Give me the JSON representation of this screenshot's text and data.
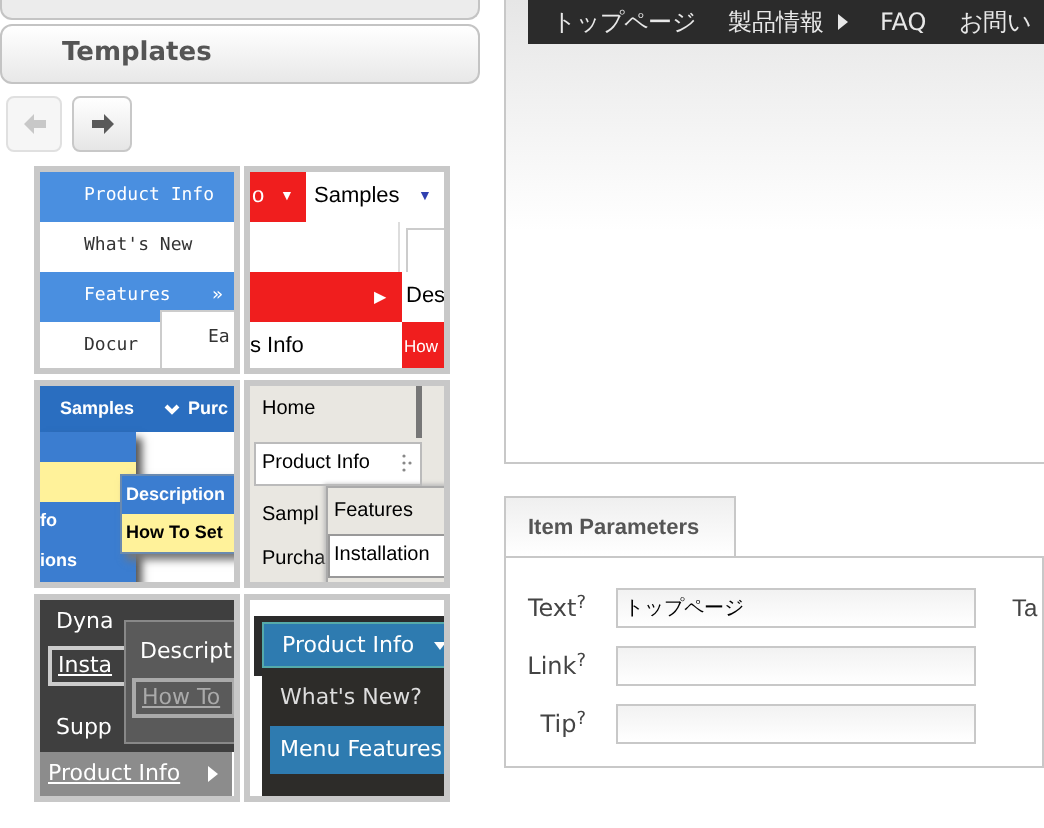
{
  "sidebar": {
    "templates_header": "Templates",
    "nav_buttons": [
      {
        "kind": "back",
        "disabled": true
      },
      {
        "kind": "forward",
        "disabled": false
      }
    ],
    "templates": [
      {
        "kind": "blue-classic",
        "items": [
          "Product Info",
          "What's New",
          "Features",
          "»",
          "Docur",
          "Ea"
        ]
      },
      {
        "kind": "red-flat",
        "items": [
          "o",
          "▼",
          "Samples",
          "▼",
          "▶",
          "Des",
          "s Info",
          "How"
        ]
      },
      {
        "kind": "blue-yellow",
        "items": [
          "Samples",
          "Purc",
          "fo",
          "ions",
          "Description",
          "How To Set"
        ]
      },
      {
        "kind": "light-gray",
        "items": [
          "Home",
          "Product Info",
          "Sampl",
          "Purcha",
          "Features",
          "Installation"
        ]
      },
      {
        "kind": "dark-gray",
        "items": [
          "Dyna",
          "Insta",
          "Supp",
          "Descript",
          "How To",
          "Product Info"
        ]
      },
      {
        "kind": "dark-steel",
        "items": [
          "Product Info",
          "What's New?",
          "Menu Features"
        ]
      }
    ]
  },
  "preview": {
    "menu_items": [
      {
        "label": "トップページ",
        "has_submenu": false
      },
      {
        "label": "製品情報",
        "has_submenu": true
      },
      {
        "label": "FAQ",
        "has_submenu": false
      },
      {
        "label": "お問い",
        "has_submenu": false
      }
    ]
  },
  "item_parameters": {
    "tab": "Item Parameters",
    "fields": [
      {
        "label": "Text$^{?}$",
        "value": "トップページ"
      },
      {
        "label": "Link$^{?}$"
      },
      {
        "label": "Tip$^{?}$"
      }
    ],
    "column_2_label": "Ta"
  }
}
